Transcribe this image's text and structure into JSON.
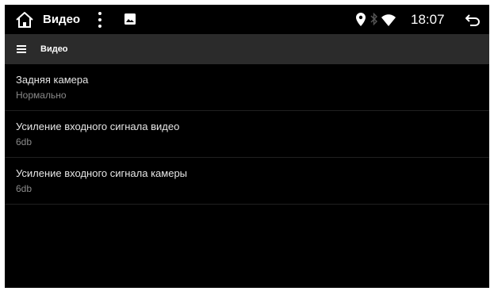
{
  "statusbar": {
    "title": "Видео",
    "time": "18:07",
    "icons": [
      "home-icon",
      "more-vert-icon",
      "image-icon",
      "location-icon",
      "bluetooth-icon",
      "wifi-icon",
      "back-icon"
    ]
  },
  "appbar": {
    "title": "Видео",
    "menu_icon": "menu-icon"
  },
  "settings": [
    {
      "label": "Задняя камера",
      "value": "Нормально"
    },
    {
      "label": "Усиление входного сигнала видео",
      "value": "6db"
    },
    {
      "label": "Усиление входного сигнала камеры",
      "value": "6db"
    }
  ]
}
